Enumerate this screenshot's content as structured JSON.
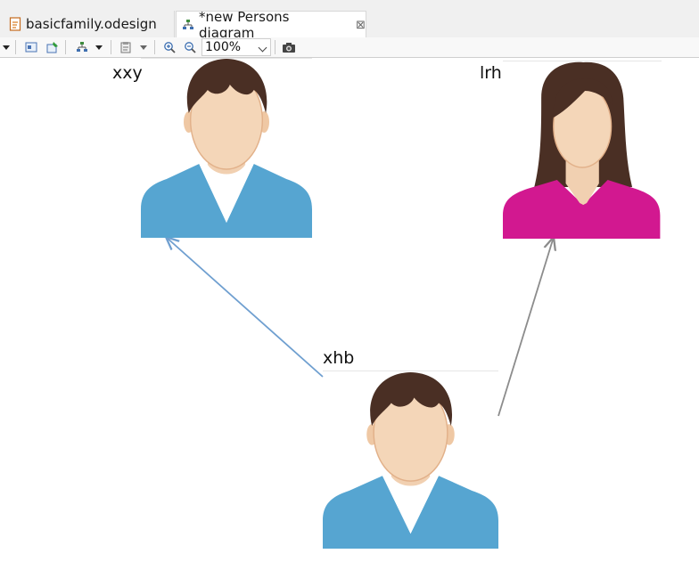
{
  "tabs": [
    {
      "label": "basicfamily.odesign",
      "active": false
    },
    {
      "label": "*new Persons diagram",
      "active": true,
      "close_icon": "close-icon"
    }
  ],
  "toolbar": {
    "zoom_value": "100%",
    "icons": [
      "select-dropdown-icon",
      "select-all-icon",
      "pin-icon",
      "layout-icon",
      "paste-format-icon",
      "zoom-in-icon",
      "zoom-out-icon",
      "export-image-icon"
    ]
  },
  "diagram": {
    "nodes": [
      {
        "name": "xxy",
        "avatar": "male-person-icon"
      },
      {
        "name": "lrh",
        "avatar": "female-person-icon"
      },
      {
        "name": "xhb",
        "avatar": "male-person-icon"
      }
    ],
    "edges": [
      {
        "from": "xhb",
        "to": "xxy",
        "color": "#6f9fd0"
      },
      {
        "from": "xhb",
        "to": "lrh",
        "color": "#8c8c8c"
      }
    ]
  },
  "colors": {
    "shirt_blue": "#56a5d1",
    "dress_magenta": "#d21890",
    "hair_brown": "#4a2f24",
    "skin": "#f3d3b4"
  }
}
